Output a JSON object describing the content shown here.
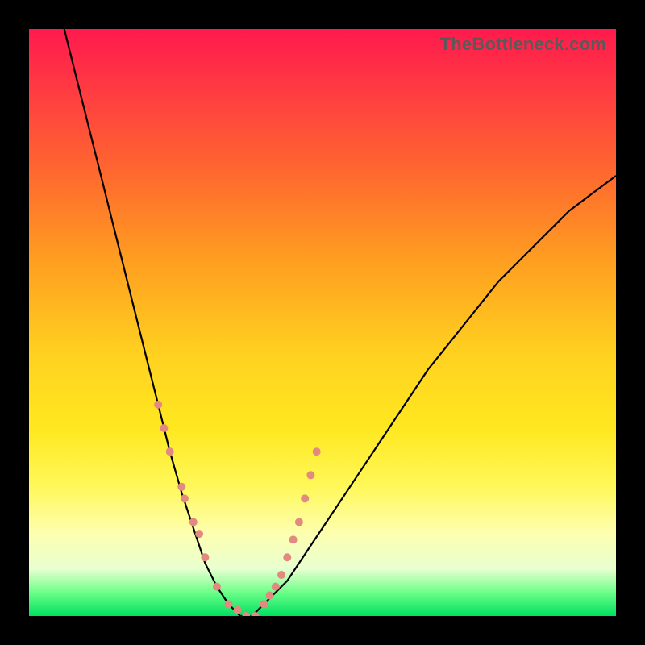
{
  "watermark": "TheBottleneck.com",
  "chart_data": {
    "type": "line",
    "title": "",
    "xlabel": "",
    "ylabel": "",
    "xlim": [
      0,
      100
    ],
    "ylim": [
      0,
      100
    ],
    "grid": false,
    "legend": false,
    "background": "gradient-red-yellow-green",
    "series": [
      {
        "name": "bottleneck-curve",
        "x": [
          6,
          8,
          10,
          12,
          14,
          16,
          18,
          20,
          22,
          24,
          26,
          28,
          30,
          32,
          34,
          36,
          38,
          40,
          44,
          48,
          52,
          56,
          60,
          64,
          68,
          72,
          76,
          80,
          84,
          88,
          92,
          96,
          100
        ],
        "y": [
          100,
          92,
          84,
          76,
          68,
          60,
          52,
          44,
          36,
          28,
          21,
          15,
          9,
          5,
          2,
          0,
          0,
          2,
          6,
          12,
          18,
          24,
          30,
          36,
          42,
          47,
          52,
          57,
          61,
          65,
          69,
          72,
          75
        ]
      }
    ],
    "markers": {
      "name": "highlight-points",
      "color": "#e28a80",
      "size": 10,
      "x": [
        22,
        23,
        24,
        26,
        26.5,
        28,
        29,
        30,
        32,
        34,
        35.5,
        37,
        38.5,
        40,
        41,
        42,
        43,
        44,
        45,
        46,
        47,
        48,
        49
      ],
      "y": [
        36,
        32,
        28,
        22,
        20,
        16,
        14,
        10,
        5,
        2,
        1,
        0,
        0,
        2,
        3.5,
        5,
        7,
        10,
        13,
        16,
        20,
        24,
        28
      ]
    }
  }
}
